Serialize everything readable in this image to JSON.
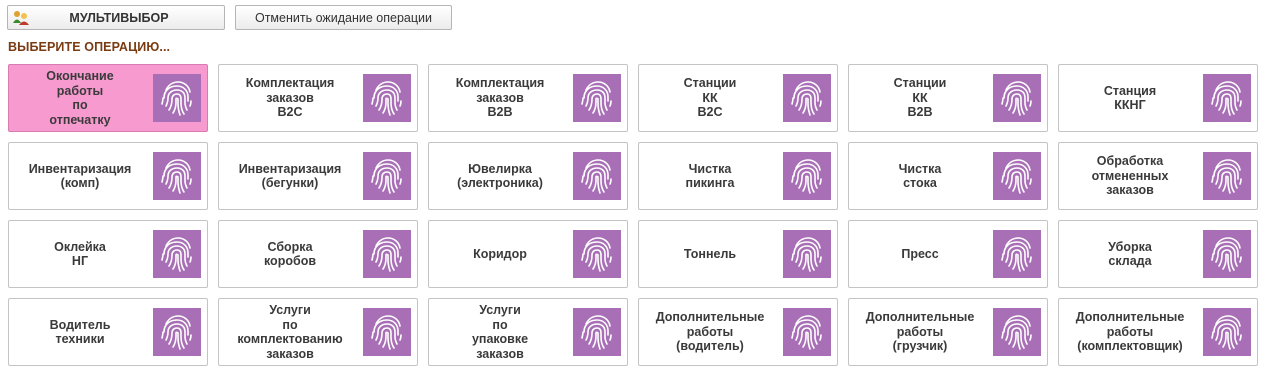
{
  "toolbar": {
    "multi_label": "МУЛЬТИВЫБОР",
    "cancel_label": "Отменить ожидание операции",
    "multi_icon": "users-icon"
  },
  "prompt": "ВЫБЕРИТЕ ОПЕРАЦИЮ...",
  "colors": {
    "active_tile": "#f79ad0",
    "fingerprint_bg": "#a96fb6",
    "prompt_text": "#7a3b12"
  },
  "operations": [
    [
      {
        "label": "Окончание\nработы\nпо\nотпечатку",
        "active": true,
        "icon": "fingerprint-icon"
      },
      {
        "label": "Комплектация\nзаказов\nB2C",
        "active": false,
        "icon": "fingerprint-icon"
      },
      {
        "label": "Комплектация\nзаказов\nB2B",
        "active": false,
        "icon": "fingerprint-icon"
      },
      {
        "label": "Станции\nКК\nB2C",
        "active": false,
        "icon": "fingerprint-icon"
      },
      {
        "label": "Станции\nКК\nB2B",
        "active": false,
        "icon": "fingerprint-icon"
      },
      {
        "label": "Станция\nККНГ",
        "active": false,
        "icon": "fingerprint-icon"
      }
    ],
    [
      {
        "label": "Инвентаризация\n(комп)",
        "active": false,
        "icon": "fingerprint-icon"
      },
      {
        "label": "Инвентаризация\n(бегунки)",
        "active": false,
        "icon": "fingerprint-icon"
      },
      {
        "label": "Ювелирка\n(электроника)",
        "active": false,
        "icon": "fingerprint-icon"
      },
      {
        "label": "Чистка\nпикинга",
        "active": false,
        "icon": "fingerprint-icon"
      },
      {
        "label": "Чистка\nстока",
        "active": false,
        "icon": "fingerprint-icon"
      },
      {
        "label": "Обработка\nотмененных\nзаказов",
        "active": false,
        "icon": "fingerprint-icon"
      }
    ],
    [
      {
        "label": "Оклейка\nНГ",
        "active": false,
        "icon": "fingerprint-icon"
      },
      {
        "label": "Сборка\nкоробов",
        "active": false,
        "icon": "fingerprint-icon"
      },
      {
        "label": "Коридор",
        "active": false,
        "icon": "fingerprint-icon"
      },
      {
        "label": "Тоннель",
        "active": false,
        "icon": "fingerprint-icon"
      },
      {
        "label": "Пресс",
        "active": false,
        "icon": "fingerprint-icon"
      },
      {
        "label": "Уборка\nсклада",
        "active": false,
        "icon": "fingerprint-icon"
      }
    ],
    [
      {
        "label": "Водитель\nтехники",
        "active": false,
        "icon": "fingerprint-icon"
      },
      {
        "label": "Услуги\nпо\nкомплектованию\nзаказов",
        "active": false,
        "icon": "fingerprint-icon"
      },
      {
        "label": "Услуги\nпо\nупаковке\nзаказов",
        "active": false,
        "icon": "fingerprint-icon"
      },
      {
        "label": "Дополнительные\nработы\n(водитель)",
        "active": false,
        "icon": "fingerprint-icon"
      },
      {
        "label": "Дополнительные\nработы\n(грузчик)",
        "active": false,
        "icon": "fingerprint-icon"
      },
      {
        "label": "Дополнительные\nработы\n(комплектовщик)",
        "active": false,
        "icon": "fingerprint-icon"
      }
    ]
  ]
}
